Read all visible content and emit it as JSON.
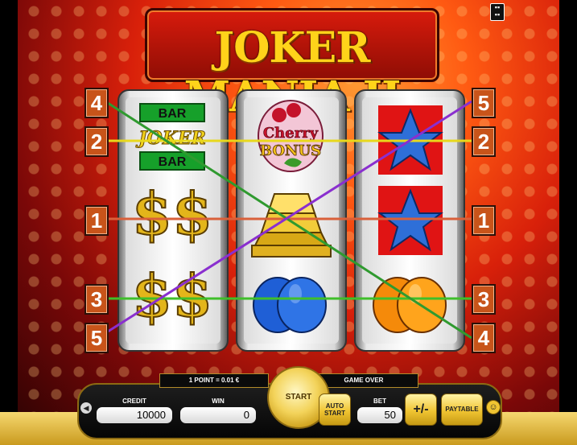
{
  "title": "JOKER MANIA II",
  "reels": [
    {
      "symbols": [
        {
          "name": "bar-joker",
          "bar_top": "BAR",
          "joker": "JOKER",
          "bar_bottom": "BAR"
        },
        {
          "name": "dollar"
        },
        {
          "name": "dollar"
        }
      ]
    },
    {
      "symbols": [
        {
          "name": "cherry-bonus",
          "line1": "Cherry",
          "line2": "BONUS"
        },
        {
          "name": "gold-bars"
        },
        {
          "name": "plum"
        }
      ]
    },
    {
      "symbols": [
        {
          "name": "star"
        },
        {
          "name": "star"
        },
        {
          "name": "apricot"
        }
      ]
    }
  ],
  "payline_numbers": {
    "left": [
      "4",
      "2",
      "1",
      "3",
      "5"
    ],
    "right": [
      "5",
      "2",
      "1",
      "3",
      "4"
    ]
  },
  "payline_colors": {
    "line1": "#d9603a",
    "line2": "#e8d81c",
    "line3": "#3fbf2a",
    "line4": "#2f9a2f",
    "line5": "#8a2fcf"
  },
  "info": {
    "point_value": "1 POINT = 0.01 €",
    "status": "GAME OVER"
  },
  "controls": {
    "credit_label": "CREDIT",
    "credit_value": "10000",
    "win_label": "WIN",
    "win_value": "0",
    "start_label": "START",
    "auto_start_line1": "AUTO",
    "auto_start_line2": "START",
    "bet_label": "BET",
    "bet_value": "50",
    "plus_minus": "+/-",
    "paytable": "PAYTABLE"
  },
  "icons": {
    "menu": "menu-grid-icon",
    "sound": "speaker-icon",
    "smiley": "smiley-icon"
  }
}
